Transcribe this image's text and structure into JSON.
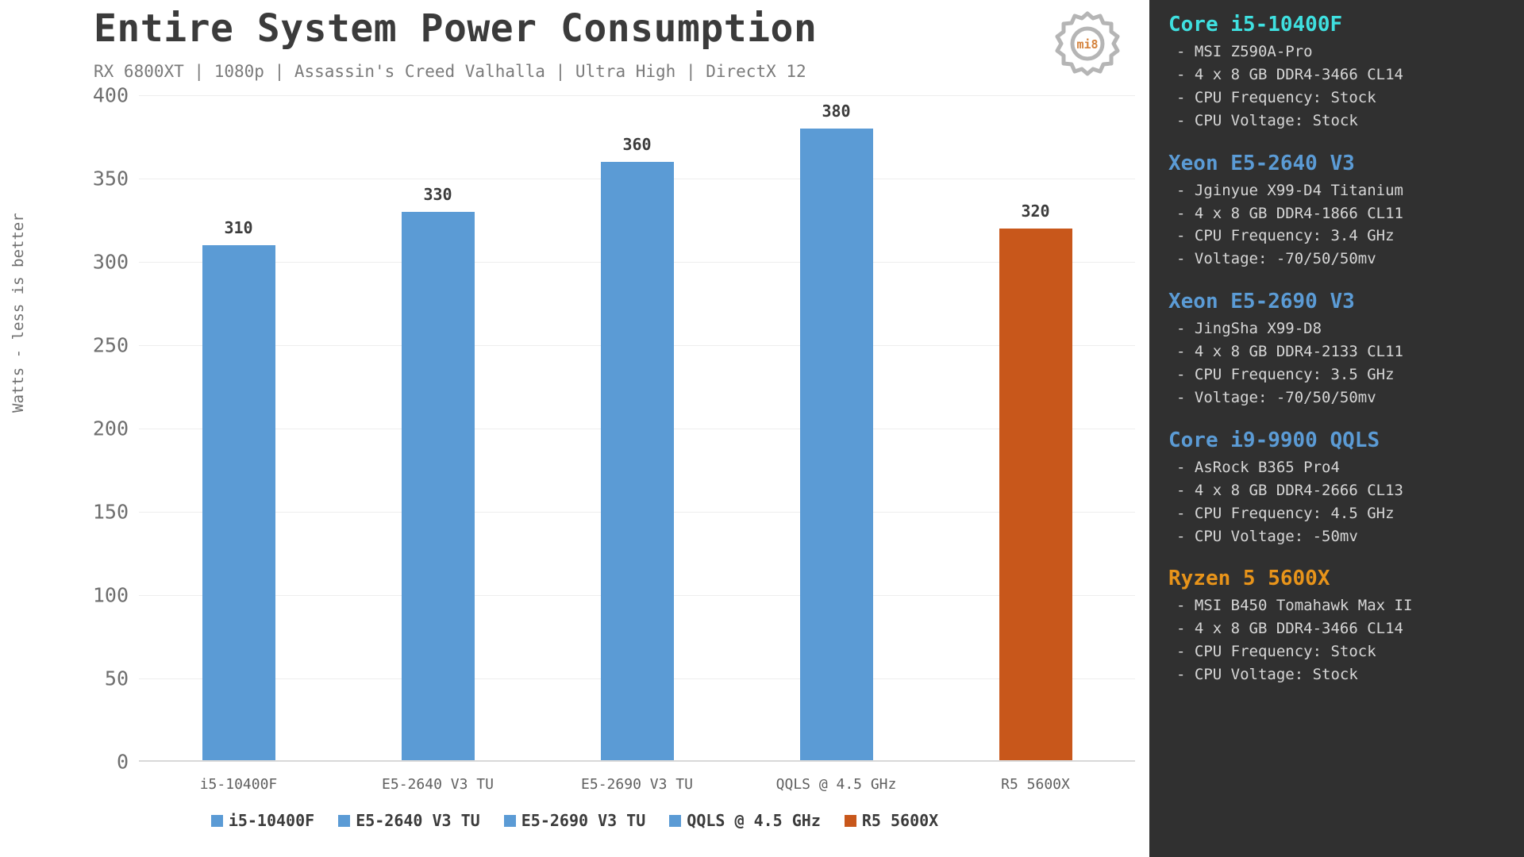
{
  "header": {
    "title": "Entire System Power Consumption",
    "subtitle": "RX 6800XT | 1080p | Assassin's Creed Valhalla | Ultra High | DirectX 12",
    "logo_text": "mi8",
    "logo_icon": "gear-icon"
  },
  "colors": {
    "bar_blue": "#5B9BD5",
    "bar_orange": "#C8571B",
    "sidebar_bg": "#303030",
    "head_cyan": "#3FE0E0",
    "head_blue": "#5B9BD5",
    "head_orange": "#E8941A",
    "text_dark": "#3b3b3b",
    "text_muted": "#6e6e6e"
  },
  "chart_data": {
    "type": "bar",
    "title": "Entire System Power Consumption",
    "subtitle": "RX 6800XT | 1080p | Assassin's Creed Valhalla | Ultra High | DirectX 12",
    "xlabel": "",
    "ylabel": "Watts - less is better",
    "ylim": [
      0,
      400
    ],
    "yticks": [
      400,
      350,
      300,
      250,
      200,
      150,
      100,
      50,
      0
    ],
    "grid": true,
    "legend_position": "bottom",
    "categories": [
      "i5-10400F",
      "E5-2640 V3 TU",
      "E5-2690 V3 TU",
      "QQLS @ 4.5 GHz",
      "R5 5600X"
    ],
    "values": [
      310,
      330,
      360,
      380,
      320
    ],
    "bar_colors": [
      "#5B9BD5",
      "#5B9BD5",
      "#5B9BD5",
      "#5B9BD5",
      "#C8571B"
    ],
    "legend": [
      {
        "label": "i5-10400F",
        "color": "#5B9BD5"
      },
      {
        "label": "E5-2640 V3 TU",
        "color": "#5B9BD5"
      },
      {
        "label": "E5-2690 V3 TU",
        "color": "#5B9BD5"
      },
      {
        "label": "QQLS @ 4.5 GHz",
        "color": "#5B9BD5"
      },
      {
        "label": "R5 5600X",
        "color": "#C8571B"
      }
    ]
  },
  "sidebar": {
    "blocks": [
      {
        "name": "Core i5-10400F",
        "color": "#3FE0E0",
        "lines": [
          "- MSI Z590A-Pro",
          "- 4 x 8 GB DDR4-3466 CL14",
          "- CPU Frequency: Stock",
          "- CPU Voltage: Stock"
        ]
      },
      {
        "name": "Xeon E5-2640 V3",
        "color": "#5B9BD5",
        "lines": [
          "- Jginyue X99-D4 Titanium",
          "- 4 x 8 GB DDR4-1866 CL11",
          "- CPU Frequency: 3.4 GHz",
          "- Voltage: -70/50/50mv"
        ]
      },
      {
        "name": "Xeon E5-2690 V3",
        "color": "#5B9BD5",
        "lines": [
          "- JingSha X99-D8",
          "- 4 x 8 GB DDR4-2133 CL11",
          "- CPU Frequency: 3.5 GHz",
          "- Voltage: -70/50/50mv"
        ]
      },
      {
        "name": "Core i9-9900 QQLS",
        "color": "#5B9BD5",
        "lines": [
          "- AsRock B365 Pro4",
          "- 4 x 8 GB DDR4-2666 CL13",
          "- CPU Frequency: 4.5 GHz",
          "- CPU Voltage: -50mv"
        ]
      },
      {
        "name": "Ryzen 5 5600X",
        "color": "#E8941A",
        "lines": [
          "- MSI B450 Tomahawk Max II",
          "- 4 x 8 GB DDR4-3466 CL14",
          "- CPU Frequency: Stock",
          "- CPU Voltage: Stock"
        ]
      }
    ]
  }
}
